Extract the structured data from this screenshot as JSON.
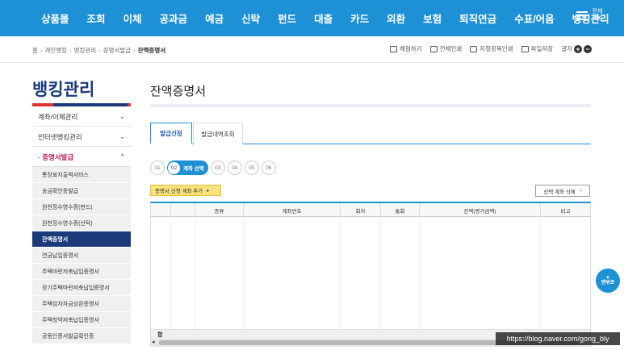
{
  "topnav": {
    "items": [
      "상품몰",
      "조회",
      "이체",
      "공과금",
      "예금",
      "신탁",
      "펀드",
      "대출",
      "카드",
      "외환",
      "보험",
      "퇴직연금",
      "수표/어음",
      "뱅킹관리"
    ],
    "all_menu_label": "전체\n메뉴"
  },
  "breadcrumb": {
    "items": [
      "홈",
      "개인뱅킹",
      "뱅킹관리",
      "증명서발급"
    ],
    "current": "잔액증명서"
  },
  "tools": {
    "guide": "체험하기",
    "print_all": "전체인쇄",
    "print_selected": "지정항목인쇄",
    "save_file": "파일저장",
    "font_label": "글자",
    "font_plus": "+",
    "font_minus": "−"
  },
  "sidebar": {
    "title": "뱅킹관리",
    "menus": [
      {
        "label": "계좌/이체관리",
        "chev": "⌄"
      },
      {
        "label": "인터넷뱅킹관리",
        "chev": "⌄"
      },
      {
        "label": "· 증명서발급",
        "chev": "⌃"
      }
    ],
    "subitems": [
      "통장표지출력서비스",
      "송금확인증발급",
      "원천징수영수증(펀드)",
      "원천징수영수증(신탁)",
      "잔액증명서",
      "연금납입증명서",
      "주택마련저축납입증명서",
      "장기주택마련저축납입증명서",
      "주택임차차금상환증명서",
      "주택청약저축납입증명서",
      "공동인증서발급확인증"
    ],
    "active_index": 4
  },
  "main": {
    "title": "잔액증명서",
    "tabs": [
      "발급신청",
      "발급내역조회"
    ],
    "steps": [
      "01",
      "02",
      "03",
      "04",
      "05",
      "06"
    ],
    "current_step_label": "계좌 선택",
    "add_button": "증명서 신청 계좌 추가",
    "delete_button": "선택 계좌 삭제",
    "table_headers": [
      "",
      "",
      "종류",
      "계좌번호",
      "회차",
      "통화",
      "잔액(평가금액)",
      "비고"
    ],
    "footer_label": "합"
  },
  "float_button": {
    "label": "맨위로",
    "arrow": "▲"
  },
  "watermark": "https://blog.naver.com/gong_bly",
  "colors": {
    "nav_blue": "#1e90d6",
    "sidebar_navy": "#1a3a7a",
    "accent_pink": "#c2185b",
    "button_yellow": "#fbe27a"
  }
}
